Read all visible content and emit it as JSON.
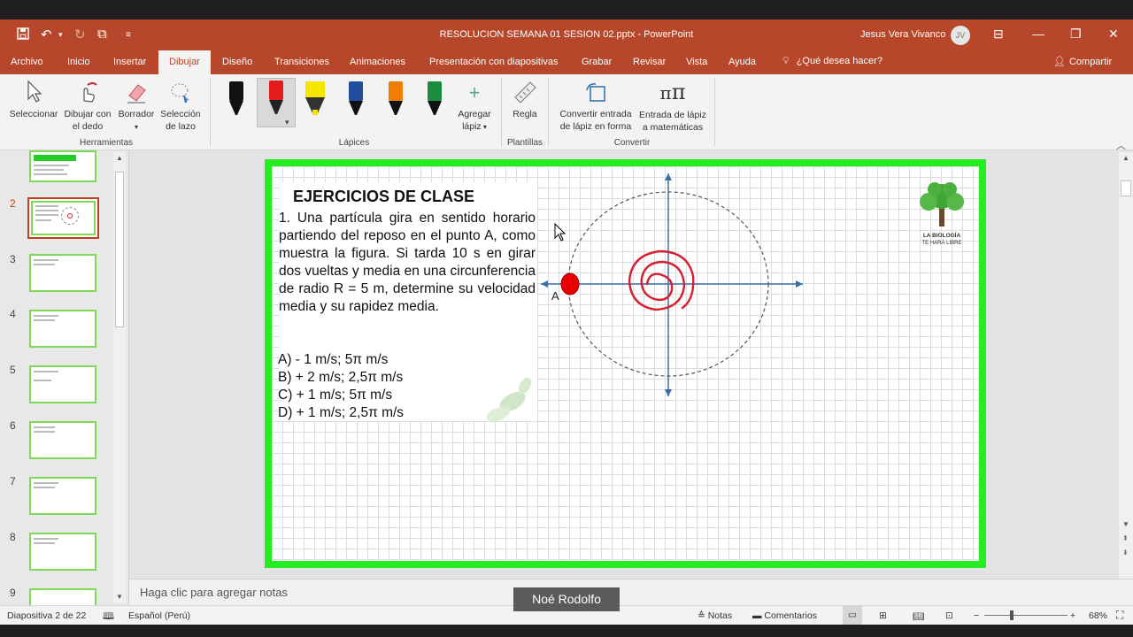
{
  "window": {
    "title": "RESOLUCION SEMANA 01 SESION 02.pptx  -  PowerPoint",
    "user": "Jesus Vera Vivanco",
    "user_initials": "JV"
  },
  "tabs": [
    "Archivo",
    "Inicio",
    "Insertar",
    "Dibujar",
    "Diseño",
    "Transiciones",
    "Animaciones",
    "Presentación con diapositivas",
    "Grabar",
    "Revisar",
    "Vista",
    "Ayuda"
  ],
  "active_tab": "Dibujar",
  "search_text": "¿Qué desea hacer?",
  "share_label": "Compartir",
  "ribbon": {
    "tools": {
      "select": "Seleccionar",
      "draw_finger_1": "Dibujar con",
      "draw_finger_2": "el dedo",
      "eraser": "Borrador",
      "lasso_1": "Selección",
      "lasso_2": "de lazo",
      "group": "Herramientas"
    },
    "pens": {
      "add_pen_1": "Agregar",
      "add_pen_2": "lápiz",
      "group": "Lápices",
      "colors": [
        "#111111",
        "#e31b1b",
        "#f5e600",
        "#1f4e9a",
        "#f07c00",
        "#1a8c3c"
      ]
    },
    "stencils": {
      "ruler": "Regla",
      "group": "Plantillas"
    },
    "convert": {
      "shapes_1": "Convertir entrada",
      "shapes_2": "de lápiz en forma",
      "math_1": "Entrada de lápiz",
      "math_2": "a matemáticas",
      "group": "Convertir"
    }
  },
  "slides_panel": {
    "numbers": [
      "2",
      "3",
      "4",
      "5",
      "6",
      "7",
      "8",
      "9"
    ],
    "current": "2"
  },
  "slide": {
    "heading": "EJERCICIOS DE CLASE",
    "problem": "1. Una partícula gira en sentido horario partiendo del reposo en el punto A, como muestra la figura. Si tarda 10 s en girar dos vueltas y media en una circunferencia de radio R = 5 m, determine su velocidad media y su rapidez media.",
    "options": [
      "A)  - 1 m/s; 5π m/s",
      "B)  + 2 m/s; 2,5π m/s",
      "C)  + 1 m/s; 5π m/s",
      "D) + 1 m/s; 2,5π m/s"
    ],
    "point_label": "A",
    "logo_line1": "LA BIOLOGÍA",
    "logo_line2": "TE HARÁ LIBRE",
    "colors": {
      "border": "#22ee22",
      "point": "#e80000",
      "ink": "#d42030",
      "axis": "#3b6ea8"
    }
  },
  "notes_placeholder": "Haga clic para agregar notas",
  "status": {
    "slide_info": "Diapositiva 2 de 22",
    "language": "Español (Perú)",
    "notes": "Notas",
    "comments": "Comentarios",
    "zoom": "68%"
  },
  "participant_name": "Noé Rodolfo"
}
